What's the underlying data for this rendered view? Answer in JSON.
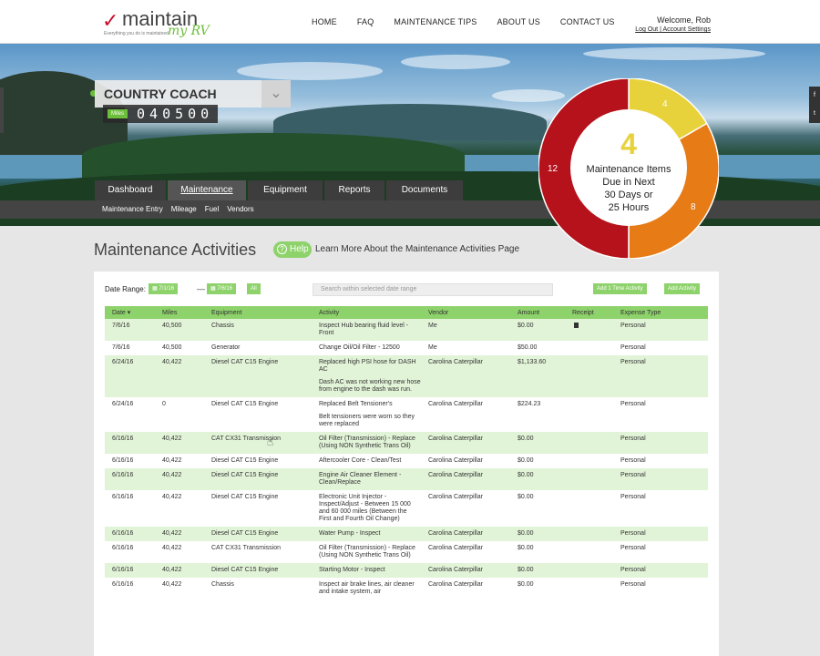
{
  "header": {
    "logo_word": "maintain",
    "logo_sub": "my RV",
    "logo_tagline": "Everything you do is maintained",
    "nav": [
      "HOME",
      "FAQ",
      "MAINTENANCE TIPS",
      "ABOUT US",
      "CONTACT US"
    ],
    "welcome": "Welcome, Rob",
    "logout": "Log Out",
    "separator": "|",
    "account_settings": "Account Settings"
  },
  "vehicle": {
    "name": "COUNTRY COACH",
    "badge": "Miles",
    "odometer": "040500"
  },
  "social": [
    "f",
    "t"
  ],
  "tabs": [
    {
      "label": "Dashboard",
      "active": false
    },
    {
      "label": "Maintenance",
      "active": true
    },
    {
      "label": "Equipment",
      "active": false
    },
    {
      "label": "Reports",
      "active": false
    },
    {
      "label": "Documents",
      "active": false
    }
  ],
  "subnav": [
    "Maintenance Entry",
    "Mileage",
    "Fuel",
    "Vendors"
  ],
  "donut": {
    "center_number": "4",
    "center_lines": [
      "Maintenance Items",
      "Due in Next",
      "30 Days or",
      "25 Hours"
    ],
    "segments": [
      {
        "label": "4",
        "value": 4,
        "color": "#e8d23c"
      },
      {
        "label": "8",
        "value": 8,
        "color": "#e77b16"
      },
      {
        "label": "12",
        "value": 12,
        "color": "#b5121b"
      }
    ]
  },
  "page": {
    "title": "Maintenance Activities",
    "help_label": "Help",
    "help_link": "Learn More About the Maintenance Activities Page"
  },
  "filters": {
    "date_range_label": "Date Range:",
    "from": "7/1/16",
    "dash": "—",
    "to": "7/6/16",
    "all": "All",
    "search_placeholder": "Search within selected date range",
    "add_time_activity": "Add 1 Time Activity",
    "add_activity": "Add Activity"
  },
  "table": {
    "columns": [
      "Date",
      "Miles",
      "Equipment",
      "Activity",
      "Vendor",
      "Amount",
      "Receipt",
      "Expense Type"
    ],
    "rows": [
      {
        "date": "7/6/16",
        "miles": "40,500",
        "equipment": "Chassis",
        "activity": "Inspect Hub bearing fluid level - Front",
        "note": "",
        "vendor": "Me",
        "amount": "$0.00",
        "receipt": true,
        "expense": "Personal"
      },
      {
        "date": "7/6/16",
        "miles": "40,500",
        "equipment": "Generator",
        "activity": "Change Oil/Oil Filter - 12500",
        "note": "",
        "vendor": "Me",
        "amount": "$50.00",
        "receipt": false,
        "expense": "Personal"
      },
      {
        "date": "6/24/16",
        "miles": "40,422",
        "equipment": "Diesel CAT C15 Engine",
        "activity": "Replaced high PSI hose for DASH AC",
        "note": "Dash AC was not working new hose from engine to the dash was run.",
        "vendor": "Carolina Caterpillar",
        "amount": "$1,133.60",
        "receipt": false,
        "expense": "Personal"
      },
      {
        "date": "6/24/16",
        "miles": "0",
        "equipment": "Diesel CAT C15 Engine",
        "activity": "Replaced Belt Tensioner's",
        "note": "Belt tensioners were worn so they were replaced",
        "vendor": "Carolina Caterpillar",
        "amount": "$224.23",
        "receipt": false,
        "expense": "Personal"
      },
      {
        "date": "6/16/16",
        "miles": "40,422",
        "equipment": "CAT CX31 Transmission",
        "activity": "Oil Filter (Transmission) - Replace (Using NON Synthetic Trans Oil)",
        "note": "",
        "vendor": "Carolina Caterpillar",
        "amount": "$0.00",
        "receipt": false,
        "expense": "Personal"
      },
      {
        "date": "6/16/16",
        "miles": "40,422",
        "equipment": "Diesel CAT C15 Engine",
        "activity": "Aftercooler Core - Clean/Test",
        "note": "",
        "vendor": "Carolina Caterpillar",
        "amount": "$0.00",
        "receipt": false,
        "expense": "Personal"
      },
      {
        "date": "6/16/16",
        "miles": "40,422",
        "equipment": "Diesel CAT C15 Engine",
        "activity": "Engine Air Cleaner Element - Clean/Replace",
        "note": "",
        "vendor": "Carolina Caterpillar",
        "amount": "$0.00",
        "receipt": false,
        "expense": "Personal"
      },
      {
        "date": "6/16/16",
        "miles": "40,422",
        "equipment": "Diesel CAT C15 Engine",
        "activity": "Electronic Unit Injector - Inspect/Adjust - Between 15 000 and 60 000 miles (Between the First and Fourth Oil Change)",
        "note": "",
        "vendor": "Carolina Caterpillar",
        "amount": "$0.00",
        "receipt": false,
        "expense": "Personal"
      },
      {
        "date": "6/16/16",
        "miles": "40,422",
        "equipment": "Diesel CAT C15 Engine",
        "activity": "Water Pump - Inspect",
        "note": "",
        "vendor": "Carolina Caterpillar",
        "amount": "$0.00",
        "receipt": false,
        "expense": "Personal"
      },
      {
        "date": "6/16/16",
        "miles": "40,422",
        "equipment": "CAT CX31 Transmission",
        "activity": "Oil Filter (Transmission) - Replace (Using NON Synthetic Trans Oil)",
        "note": "",
        "vendor": "Carolina Caterpillar",
        "amount": "$0.00",
        "receipt": false,
        "expense": "Personal"
      },
      {
        "date": "6/16/16",
        "miles": "40,422",
        "equipment": "Diesel CAT C15 Engine",
        "activity": "Starting Motor - Inspect",
        "note": "",
        "vendor": "Carolina Caterpillar",
        "amount": "$0.00",
        "receipt": false,
        "expense": "Personal"
      },
      {
        "date": "6/16/16",
        "miles": "40,422",
        "equipment": "Chassis",
        "activity": "Inspect air brake lines, air cleaner and intake system, air",
        "note": "",
        "vendor": "Carolina Caterpillar",
        "amount": "$0.00",
        "receipt": false,
        "expense": "Personal"
      }
    ]
  }
}
